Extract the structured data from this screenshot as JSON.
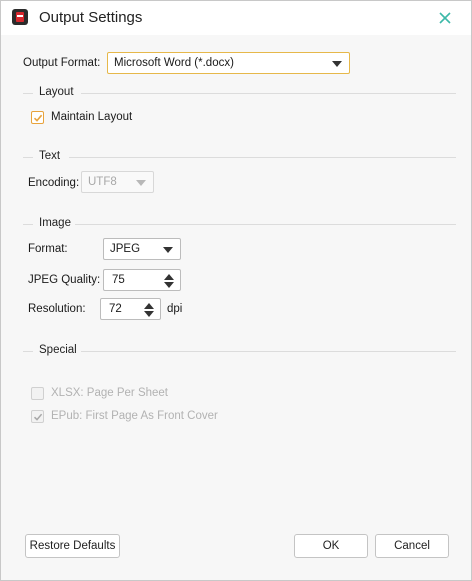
{
  "window": {
    "title": "Output Settings",
    "app_icon": "pdf-app-icon",
    "close_icon": "close-icon"
  },
  "output_format": {
    "label": "Output Format:",
    "value": "Microsoft Word (*.docx)"
  },
  "layout": {
    "section_title": "Layout",
    "maintain_layout_label": "Maintain Layout",
    "maintain_layout_checked": true
  },
  "text": {
    "section_title": "Text",
    "encoding_label": "Encoding:",
    "encoding_value": "UTF8"
  },
  "image": {
    "section_title": "Image",
    "format_label": "Format:",
    "format_value": "JPEG",
    "quality_label": "JPEG Quality:",
    "quality_value": "75",
    "resolution_label": "Resolution:",
    "resolution_value": "72",
    "resolution_unit": "dpi"
  },
  "special": {
    "section_title": "Special",
    "xlsx_label": "XLSX: Page Per Sheet",
    "xlsx_checked": false,
    "epub_label": "EPub: First Page As Front Cover",
    "epub_checked": true
  },
  "buttons": {
    "restore": "Restore Defaults",
    "ok": "OK",
    "cancel": "Cancel"
  },
  "colors": {
    "accent": "#e8a33c",
    "close_icon": "#3cb8a8"
  }
}
